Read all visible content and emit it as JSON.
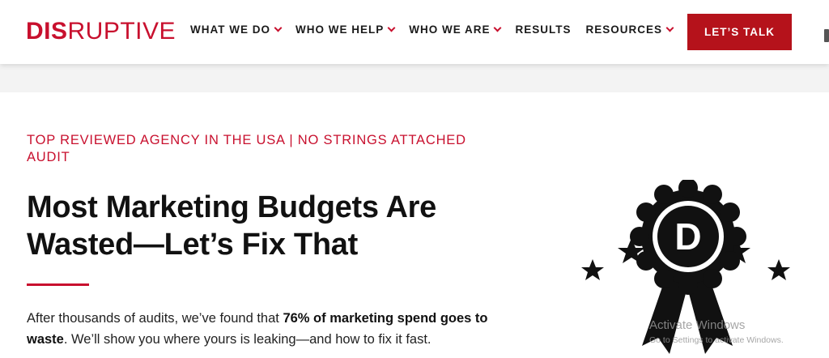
{
  "brand": {
    "logo_bold": "DIS",
    "logo_rest": "RUPTIVE",
    "accent": "#c8102e",
    "cta_bg": "#b5121b"
  },
  "nav": {
    "items": [
      {
        "label": "WHAT WE DO",
        "has_dropdown": true
      },
      {
        "label": "WHO WE HELP",
        "has_dropdown": true
      },
      {
        "label": "WHO WE ARE",
        "has_dropdown": true
      },
      {
        "label": "RESULTS",
        "has_dropdown": false
      },
      {
        "label": "RESOURCES",
        "has_dropdown": true
      }
    ],
    "cta_label": "LET’S TALK"
  },
  "hero": {
    "eyebrow": "TOP REVIEWED AGENCY IN THE USA | NO STRINGS ATTACHED AUDIT",
    "headline_line1": "Most Marketing Budgets Are",
    "headline_line2": "Wasted—Let’s Fix That",
    "body_pre": "After thousands of audits, we’ve found that ",
    "body_bold": "76% of marketing spend goes to waste",
    "body_post": ". We’ll show you where yours is leaking—and how to fix it fast.",
    "badge_icon": "award-ribbon-icon",
    "badge_monogram": "D"
  },
  "watermark": {
    "title": "Activate Windows",
    "subtitle": "Go to Settings to activate Windows."
  }
}
